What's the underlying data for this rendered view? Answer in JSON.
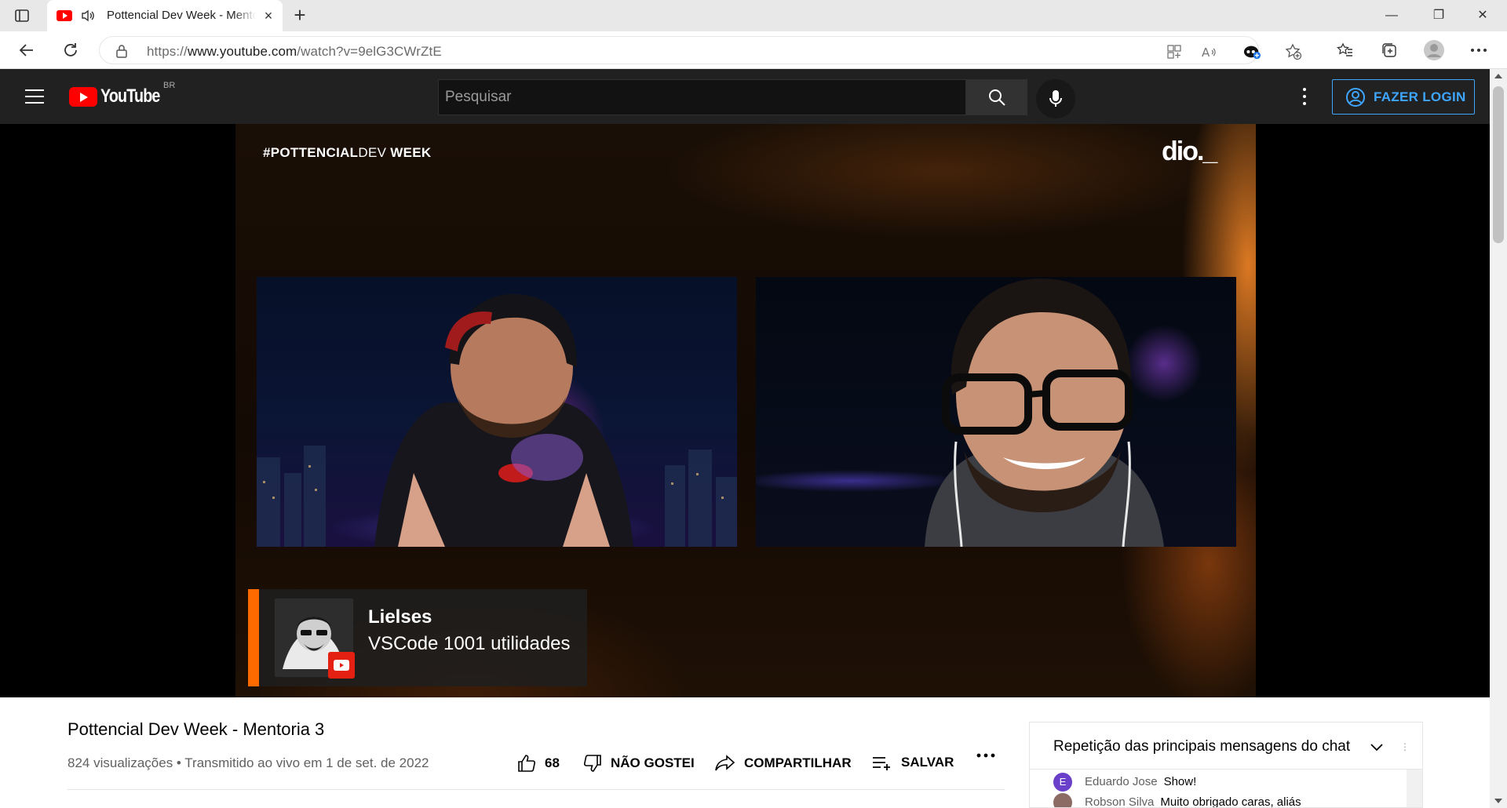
{
  "browser": {
    "tab_title": "Pottencial Dev Week - Mentoria 3",
    "tab_close": "×",
    "new_tab": "+",
    "window_controls": {
      "minimize": "—",
      "maximize": "❐",
      "close": "✕"
    },
    "url_prefix": "https://",
    "url_host": "www.youtube.com",
    "url_path": "/watch?v=9elG3CWrZtE"
  },
  "yt": {
    "logo_text": "YouTube",
    "country_code": "BR",
    "search_placeholder": "Pesquisar",
    "login_label": "FAZER LOGIN"
  },
  "stream": {
    "hashtag_bold": "#POTTENCIAL",
    "hashtag_light": "DEV",
    "hashtag_end": " WEEK",
    "brand_logo": "dio._",
    "presenter_name": "Lielses",
    "presenter_topic": "VSCode 1001 utilidades"
  },
  "video": {
    "title": "Pottencial Dev Week - Mentoria 3",
    "meta": "824 visualizações • Transmitido ao vivo em 1 de set. de 2022",
    "like_count": "68",
    "dislike_label": "NÃO GOSTEI",
    "share_label": "COMPARTILHAR",
    "save_label": "SALVAR",
    "more_label": "..."
  },
  "chat": {
    "header": "Repetição das principais mensagens do chat",
    "messages": [
      {
        "initial": "E",
        "author": "Eduardo Jose",
        "text": "Show!",
        "color": "#6a3fc9"
      },
      {
        "initial": "",
        "author": "Robson Silva",
        "text": "Muito obrigado caras, aliás",
        "color": "#8b6b63"
      }
    ]
  },
  "colors": {
    "yt_red": "#ff0000",
    "login_blue": "#3ea6ff",
    "accent_orange": "#ff6a00",
    "header_bg": "#212121"
  }
}
